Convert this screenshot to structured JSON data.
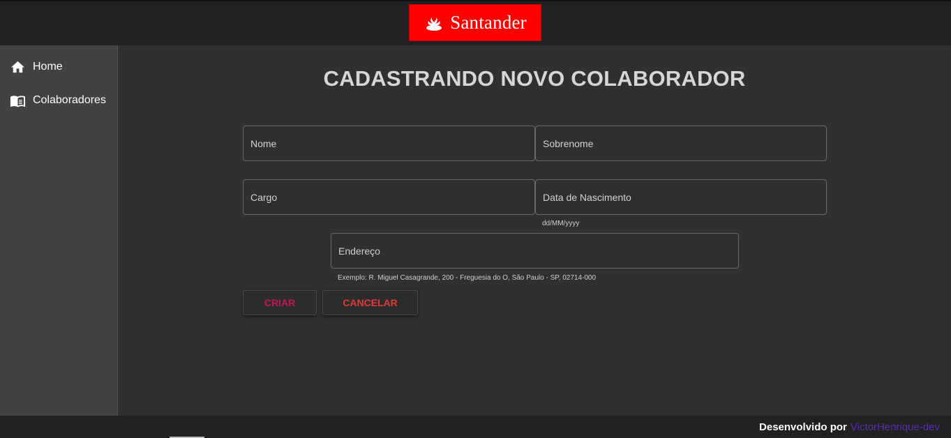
{
  "header": {
    "logo_text": "Santander",
    "logo_color": "#ff0000",
    "logo_icon": "santander-flame-icon"
  },
  "sidebar": {
    "items": [
      {
        "label": "Home",
        "icon": "home-icon"
      },
      {
        "label": "Colaboradores",
        "icon": "book-icon"
      }
    ]
  },
  "main": {
    "title": "CADASTRANDO NOVO COLABORADOR",
    "fields": {
      "nome": {
        "placeholder": "Nome",
        "value": ""
      },
      "sobrenome": {
        "placeholder": "Sobrenome",
        "value": ""
      },
      "cargo": {
        "placeholder": "Cargo",
        "value": ""
      },
      "nascimento": {
        "placeholder": "Data de Nascimento",
        "value": "",
        "hint": "dd/MM/yyyy"
      },
      "endereco": {
        "placeholder": "Endereço",
        "value": "",
        "hint": "Exemplo: R. Miguel Casagrande, 200 - Freguesia do O, São Paulo - SP, 02714-000"
      }
    },
    "buttons": {
      "create": "CRIAR",
      "cancel": "CANCELAR"
    }
  },
  "footer": {
    "text": "Desenvolvido por",
    "link": "VictorHenrique-dev",
    "link_color": "#5b2bb5"
  }
}
